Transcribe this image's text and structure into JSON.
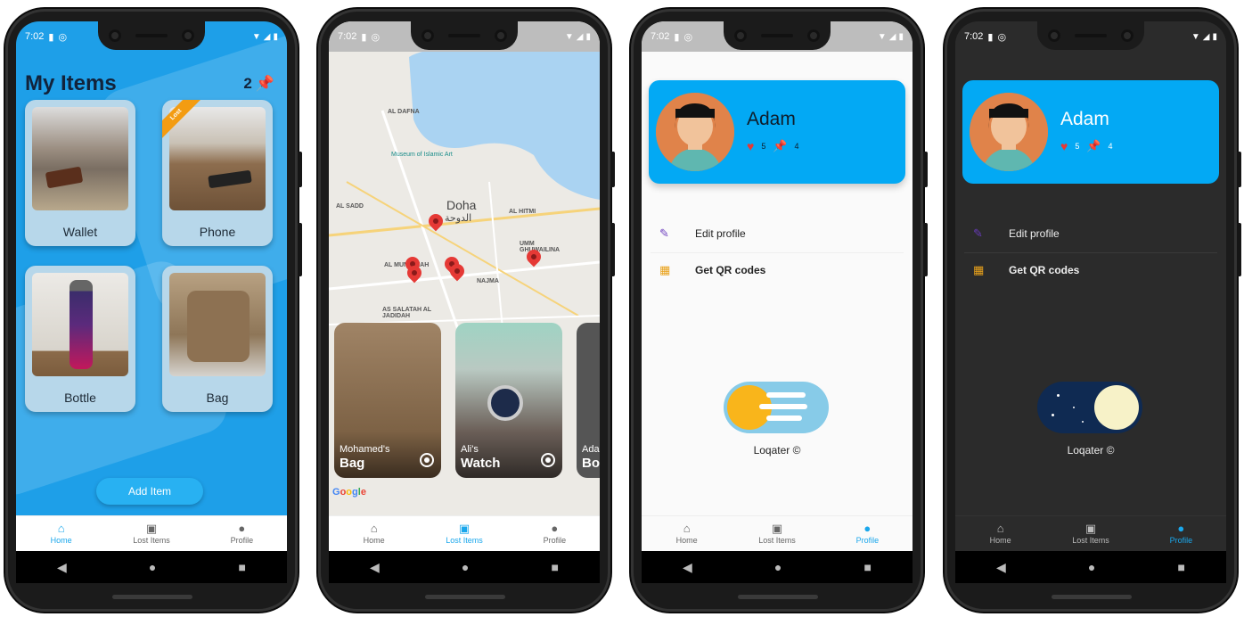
{
  "status": {
    "time": "7:02"
  },
  "home": {
    "title": "My Items",
    "count": "2",
    "items": [
      {
        "label": "Wallet"
      },
      {
        "label": "Phone",
        "badge": "Lost"
      },
      {
        "label": "Bottle"
      },
      {
        "label": "Bag"
      }
    ],
    "add_button": "Add Item"
  },
  "map": {
    "labels": [
      "AL DAFNA",
      "Museum of Islamic Art",
      "Doha",
      "الدوحة",
      "AL SADD",
      "AL HITMI",
      "UMM GHUWAILINA",
      "AL MUNTAZAH",
      "NAJMA",
      "AS SALATAH AL JADIDAH"
    ],
    "cards": [
      {
        "owner": "Mohamed's",
        "item": "Bag"
      },
      {
        "owner": "Ali's",
        "item": "Watch"
      },
      {
        "owner": "Ada",
        "item": "Bo"
      }
    ],
    "google": "Google"
  },
  "profile": {
    "name": "Adam",
    "hearts": "5",
    "pins": "4",
    "menu": [
      {
        "label": "Edit profile"
      },
      {
        "label": "Get QR codes"
      }
    ],
    "brand": "Loqater ©"
  },
  "nav": {
    "home": "Home",
    "lost": "Lost Items",
    "profile": "Profile"
  },
  "colors": {
    "accent": "#1aa7ec",
    "card": "#03a9f4",
    "dark_bg": "#2b2b2b"
  }
}
